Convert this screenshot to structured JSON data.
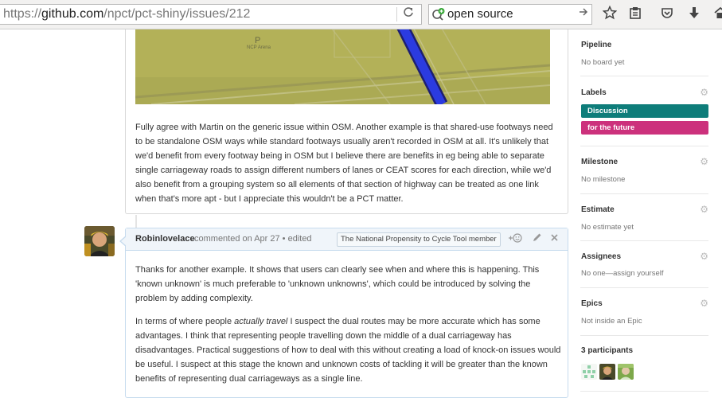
{
  "browser": {
    "url_prefix": "https://",
    "url_host": "github.com",
    "url_path": "/npct/pct-shiny/issues/212",
    "search_text": "open source",
    "icons": [
      "reload-icon",
      "search-engine-icon",
      "go-arrow-icon",
      "star-icon",
      "reading-list-icon",
      "pocket-icon",
      "download-icon",
      "home-icon"
    ]
  },
  "first_comment": {
    "text": "Fully agree with Martin on the generic issue within OSM. Another example is that shared-use footways need to be standalone OSM ways while standard footways usually aren't recorded in OSM at all. It's unlikely that we'd benefit from every footway being in OSM but I believe there are benefits in eg being able to separate single carriageway roads to assign different numbers of lanes or CEAT scores for each direction, while we'd also benefit from a grouping system so all elements of that section of highway can be treated as one link when that's more apt - but I appreciate this wouldn't be a PCT matter."
  },
  "map": {
    "parking_label": "P",
    "parking_sublabel": "NCP Arena"
  },
  "second_comment": {
    "author": "Robinlovelace",
    "meta": "commented on Apr 27 • edited",
    "badge": "The National Propensity to Cycle Tool member",
    "paragraph1": "Thanks for another example. It shows that users can clearly see when and where this is happening. This 'known unknown' is much preferable to 'unknown unknowns', which could be introduced by solving the problem by adding complexity.",
    "paragraph2_before": "In terms of where people ",
    "paragraph2_em": "actually travel",
    "paragraph2_after": " I suspect the dual routes may be more accurate which has some advantages. I think that representing people travelling down the middle of a dual carriageway has disadvantages. Practical suggestions of how to deal with this without creating a load of knock-on issues would be useful. I suspect at this stage the known and unknown costs of tackling it will be greater than the known benefits of representing dual carriageways as a single line."
  },
  "sidebar": {
    "pipeline": {
      "title": "Pipeline",
      "value": "No board yet"
    },
    "labels": {
      "title": "Labels",
      "items": [
        {
          "text": "Discussion",
          "color": "#0e7d7a"
        },
        {
          "text": "for the future",
          "color": "#cc317c"
        }
      ]
    },
    "milestone": {
      "title": "Milestone",
      "value": "No milestone"
    },
    "estimate": {
      "title": "Estimate",
      "value": "No estimate yet"
    },
    "assignees": {
      "title": "Assignees",
      "value": "No one—assign yourself"
    },
    "epics": {
      "title": "Epics",
      "value": "Not inside an Epic"
    },
    "participants": {
      "title": "3 participants"
    }
  }
}
